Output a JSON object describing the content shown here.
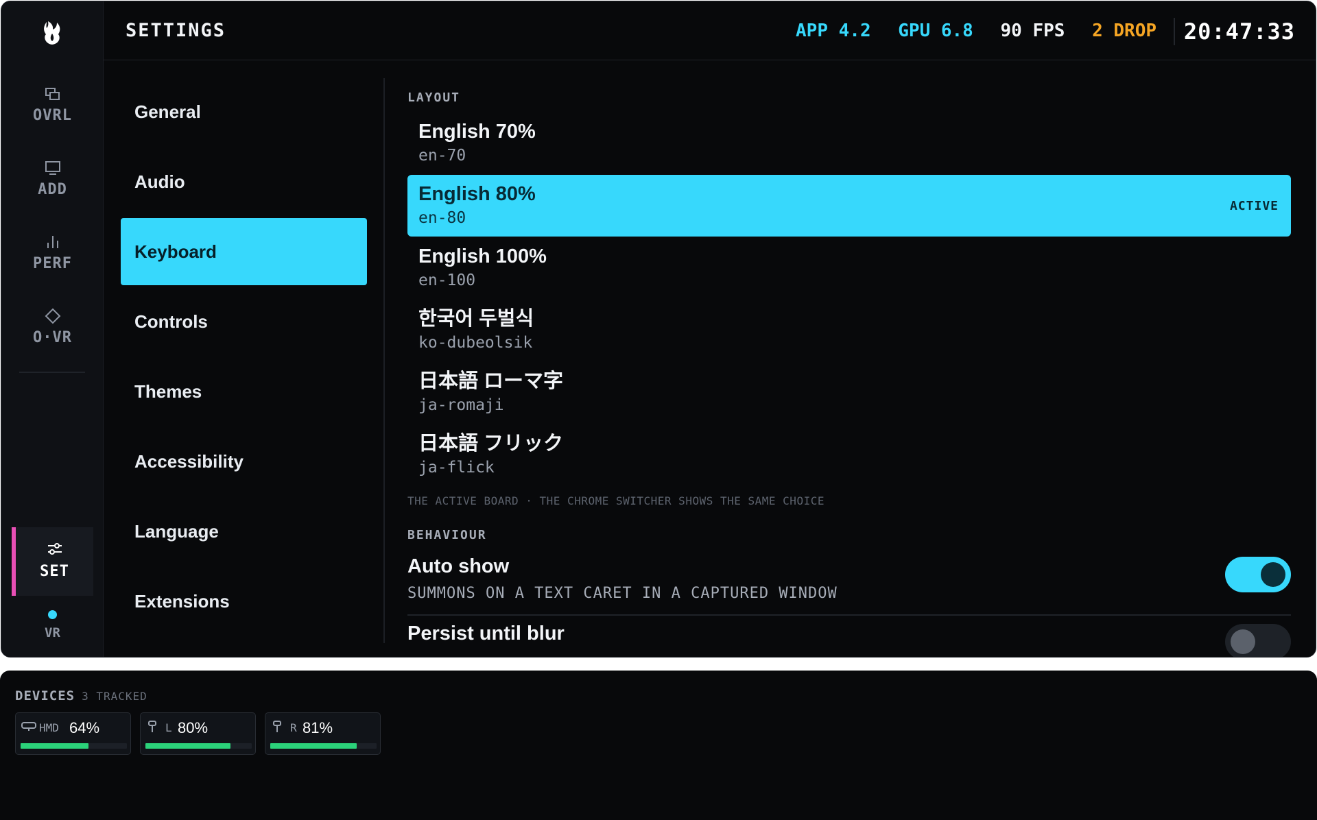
{
  "rail": {
    "items": [
      {
        "label": "OVRL",
        "icon": "overlay-icon"
      },
      {
        "label": "ADD",
        "icon": "monitor-icon"
      },
      {
        "label": "PERF",
        "icon": "bars-icon"
      },
      {
        "label": "O·VR",
        "icon": "diamond-icon"
      }
    ],
    "active": {
      "label": "SET",
      "icon": "sliders-icon"
    },
    "vr_label": "VR"
  },
  "topbar": {
    "title": "SETTINGS",
    "stats": {
      "app": "APP 4.2",
      "gpu": "GPU 6.8",
      "fps": "90 FPS",
      "drop": "2 DROP"
    },
    "clock": "20:47:33"
  },
  "nav": {
    "items": [
      "General",
      "Audio",
      "Keyboard",
      "Controls",
      "Themes",
      "Accessibility",
      "Language",
      "Extensions"
    ],
    "active_index": 2
  },
  "layout": {
    "label": "LAYOUT",
    "items": [
      {
        "name": "English 70%",
        "code": "en-70"
      },
      {
        "name": "English 80%",
        "code": "en-80",
        "badge": "ACTIVE"
      },
      {
        "name": "English 100%",
        "code": "en-100"
      },
      {
        "name": "한국어 두벌식",
        "code": "ko-dubeolsik"
      },
      {
        "name": "日本語 ローマ字",
        "code": "ja-romaji"
      },
      {
        "name": "日本語 フリック",
        "code": "ja-flick"
      }
    ],
    "hint": "THE ACTIVE BOARD · THE CHROME SWITCHER SHOWS THE SAME CHOICE"
  },
  "behaviour": {
    "label": "BEHAVIOUR",
    "auto_show": {
      "title": "Auto show",
      "desc": "SUMMONS ON A TEXT CARET IN A CAPTURED WINDOW",
      "on": true
    },
    "persist": {
      "title": "Persist until blur",
      "on": false
    }
  },
  "devices": {
    "title": "DEVICES",
    "count": "3 TRACKED",
    "items": [
      {
        "name": "HMD",
        "pct": "64%",
        "level": 0.64,
        "icon": "headset-icon"
      },
      {
        "name": "L",
        "pct": "80%",
        "level": 0.8,
        "icon": "controller-icon"
      },
      {
        "name": "R",
        "pct": "81%",
        "level": 0.81,
        "icon": "controller-icon"
      }
    ]
  },
  "colors": {
    "accent": "#37d8fc",
    "pink": "#e84fb5",
    "orange": "#f5a524",
    "battery": "#2bd27a"
  }
}
